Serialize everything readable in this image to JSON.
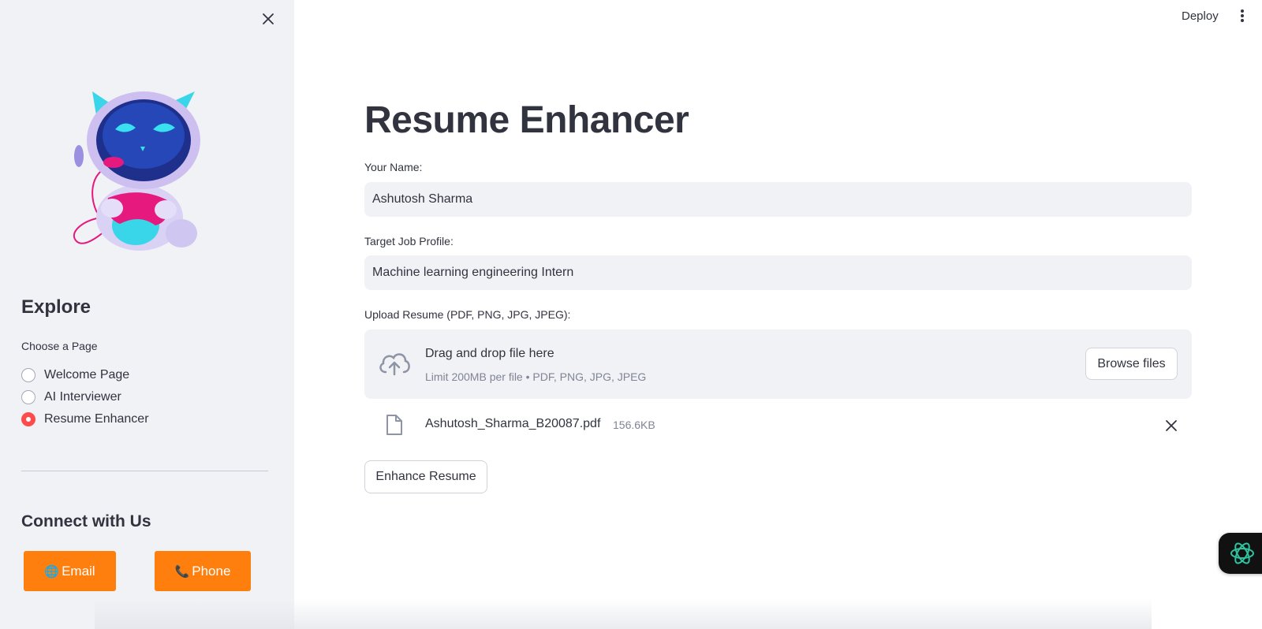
{
  "sidebar": {
    "close_icon": "close-icon",
    "mascot": "robot-mascot-illustration",
    "explore_title": "Explore",
    "choose_label": "Choose a Page",
    "pages": [
      {
        "label": "Welcome Page",
        "selected": false
      },
      {
        "label": "AI Interviewer",
        "selected": false
      },
      {
        "label": "Resume Enhancer",
        "selected": true
      }
    ],
    "connect_title": "Connect with Us",
    "email_button": {
      "icon": "🌐",
      "label": "Email"
    },
    "phone_button": {
      "icon": "📞",
      "label": "Phone"
    }
  },
  "header": {
    "deploy_label": "Deploy",
    "menu_icon": "kebab-menu-icon"
  },
  "main": {
    "title": "Resume Enhancer",
    "name_label": "Your Name:",
    "name_value": "Ashutosh Sharma",
    "job_label": "Target Job Profile:",
    "job_value": "Machine learning engineering Intern",
    "upload_label": "Upload Resume (PDF, PNG, JPG, JPEG):",
    "dropzone": {
      "title": "Drag and drop file here",
      "limit": "Limit 200MB per file • PDF, PNG, JPG, JPEG",
      "browse_label": "Browse files",
      "icon": "cloud-upload-icon"
    },
    "uploaded_file": {
      "name": "Ashutosh_Sharma_B20087.pdf",
      "size": "156.6KB",
      "icon": "file-icon"
    },
    "enhance_label": "Enhance Resume"
  },
  "colors": {
    "sidebar_bg": "#f0f2f6",
    "accent_red": "#ff4b4b",
    "button_orange": "#ff7f0e",
    "text": "#31333f",
    "muted": "#808495"
  }
}
